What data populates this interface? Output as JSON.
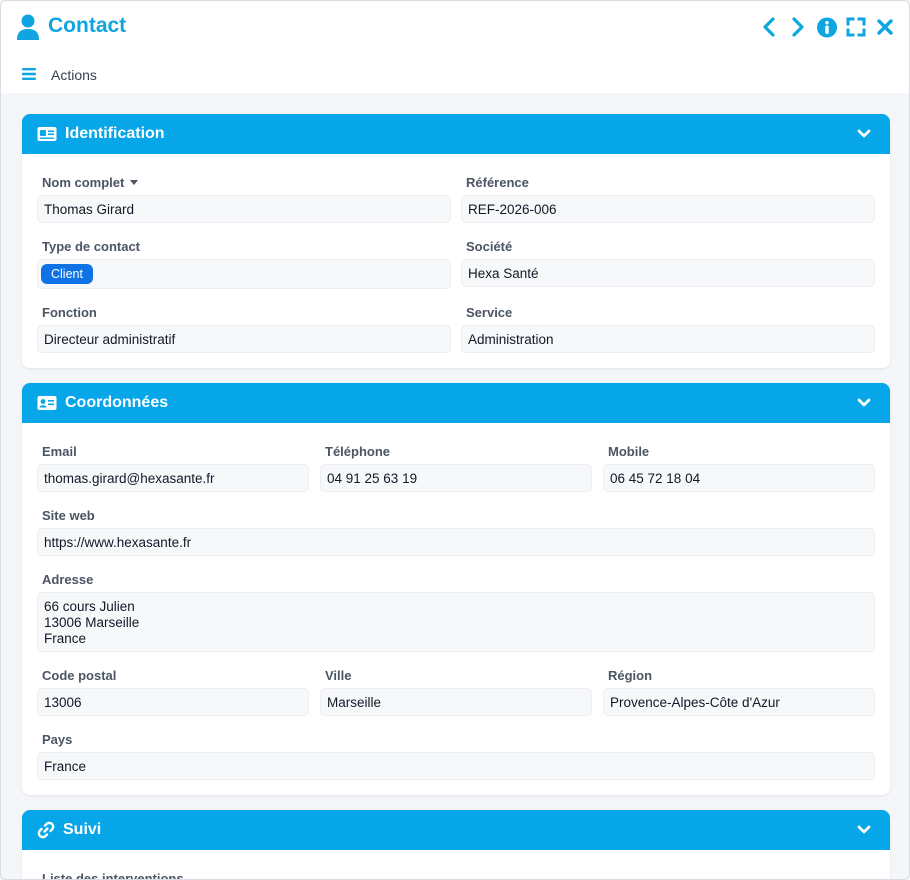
{
  "window": {
    "title": "Contact",
    "actions_label": "Actions"
  },
  "colors": {
    "accent": "#0ea5e0",
    "panel_header": "#06a6e8",
    "badge": "#0f73e6"
  },
  "icons": {
    "title": "user-icon",
    "prev": "chevron-left-icon",
    "next": "chevron-right-icon",
    "info": "info-icon",
    "fullscreen": "expand-icon",
    "close": "close-icon",
    "menu": "hamburger-icon"
  },
  "identification": {
    "title": "Identification",
    "nom_label": "Nom complet",
    "nom_value": "Thomas Girard",
    "ref_label": "Référence",
    "ref_value": "REF-2026-006",
    "type_label": "Type de contact",
    "type_value": "Client",
    "societe_label": "Société",
    "societe_value": "Hexa Santé",
    "fonction_label": "Fonction",
    "fonction_value": "Directeur administratif",
    "service_label": "Service",
    "service_value": "Administration"
  },
  "coordonnees": {
    "title": "Coordonnées",
    "email_label": "Email",
    "email_value": "thomas.girard@hexasante.fr",
    "tel_label": "Téléphone",
    "tel_value": "04 91 25 63 19",
    "mobile_label": "Mobile",
    "mobile_value": "06 45 72 18 04",
    "site_label": "Site web",
    "site_value": "https://www.hexasante.fr",
    "adresse_label": "Adresse",
    "adresse_value": "66 cours Julien\n13006 Marseille\nFrance",
    "cp_label": "Code postal",
    "cp_value": "13006",
    "ville_label": "Ville",
    "ville_value": "Marseille",
    "region_label": "Région",
    "region_value": "Provence-Alpes-Côte d'Azur",
    "pays_label": "Pays",
    "pays_value": "France"
  },
  "suivi": {
    "title": "Suivi",
    "interventions_label": "Liste des interventions"
  }
}
